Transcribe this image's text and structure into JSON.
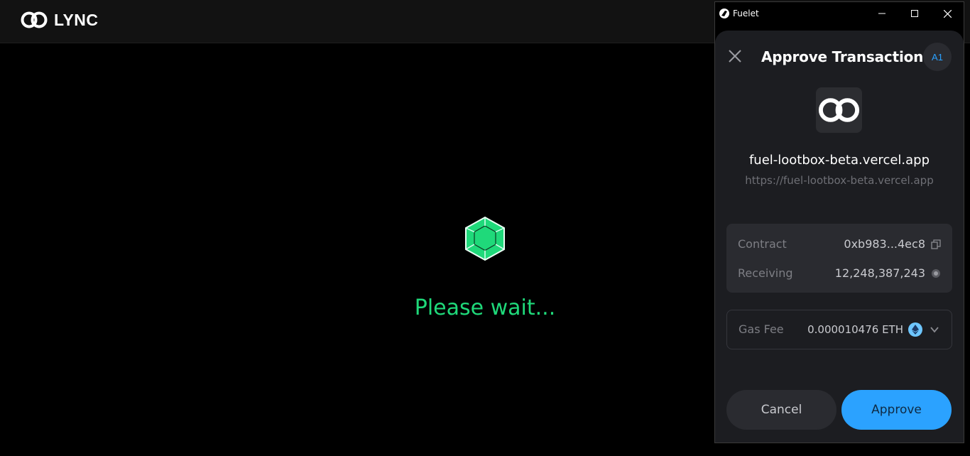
{
  "background_app": {
    "brand": "LYNC",
    "loading_text": "Please wait...",
    "accent_color": "#1fd97a"
  },
  "wallet_window": {
    "title": "Fuelet",
    "controls": [
      "minimize-icon",
      "maximize-icon",
      "close-icon"
    ]
  },
  "dialog": {
    "title": "Approve Transaction",
    "account_badge": "A1",
    "site_name": "fuel-lootbox-beta.vercel.app",
    "site_url": "https://fuel-lootbox-beta.vercel.app",
    "details": {
      "contract_label": "Contract",
      "contract_value": "0xb983...4ec8",
      "receiving_label": "Receiving",
      "receiving_value": "12,248,387,243"
    },
    "gas": {
      "label": "Gas Fee",
      "value": "0.000010476 ETH"
    },
    "buttons": {
      "cancel": "Cancel",
      "approve": "Approve"
    },
    "accent_color": "#2ba2ff"
  }
}
